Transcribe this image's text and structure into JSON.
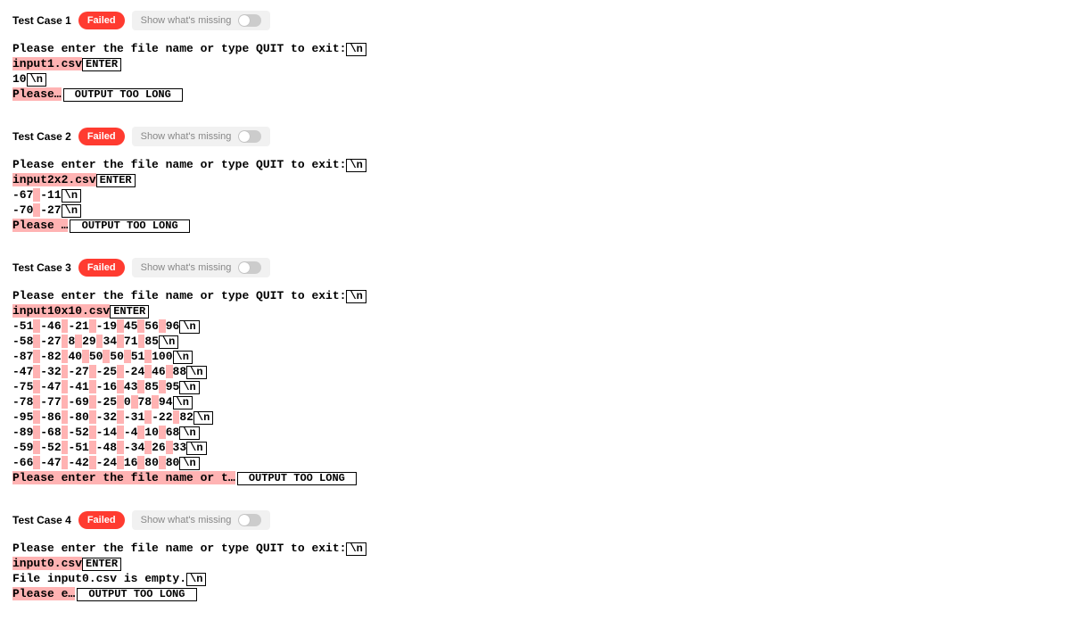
{
  "labels": {
    "swm": "Show what's missing",
    "nl": "\\n",
    "enter": "ENTER",
    "otl": "OUTPUT TOO LONG"
  },
  "tests": [
    {
      "title": "Test Case 1",
      "status": "Failed",
      "lines": [
        {
          "segs": [
            "Please enter the file name or type QUIT to exit:",
            {
              "t": "nl"
            }
          ]
        },
        {
          "segs": [
            {
              "hl": "input1.csv"
            },
            {
              "t": "enter"
            }
          ]
        },
        {
          "segs": [
            "10",
            {
              "t": "nl"
            }
          ]
        },
        {
          "segs": [
            {
              "hl": "Please…"
            },
            {
              "t": "otl"
            }
          ]
        }
      ]
    },
    {
      "title": "Test Case 2",
      "status": "Failed",
      "lines": [
        {
          "segs": [
            "Please enter the file name or type QUIT to exit:",
            {
              "t": "nl"
            }
          ]
        },
        {
          "segs": [
            {
              "hl": "input2x2.csv"
            },
            {
              "t": "enter"
            }
          ]
        },
        {
          "segs": [
            "-67",
            {
              "hl": " "
            },
            "-11",
            {
              "t": "nl"
            }
          ]
        },
        {
          "segs": [
            "-70",
            {
              "hl": " "
            },
            "-27",
            {
              "t": "nl"
            }
          ]
        },
        {
          "segs": [
            {
              "hl": "Please …"
            },
            {
              "t": "otl"
            }
          ]
        }
      ]
    },
    {
      "title": "Test Case 3",
      "status": "Failed",
      "lines": [
        {
          "segs": [
            "Please enter the file name or type QUIT to exit:",
            {
              "t": "nl"
            }
          ]
        },
        {
          "segs": [
            {
              "hl": "input10x10.csv"
            },
            {
              "t": "enter"
            }
          ]
        },
        {
          "segs": [
            "-51",
            {
              "hl": " "
            },
            "-46",
            {
              "hl": " "
            },
            "-21",
            {
              "hl": " "
            },
            "-19",
            {
              "hl": " "
            },
            "45",
            {
              "hl": " "
            },
            "56",
            {
              "hl": " "
            },
            "96",
            {
              "t": "nl"
            }
          ]
        },
        {
          "segs": [
            "-58",
            {
              "hl": " "
            },
            "-27",
            {
              "hl": " "
            },
            "8",
            {
              "hl": " "
            },
            "29",
            {
              "hl": " "
            },
            "34",
            {
              "hl": " "
            },
            "71",
            {
              "hl": " "
            },
            "85",
            {
              "t": "nl"
            }
          ]
        },
        {
          "segs": [
            "-87",
            {
              "hl": " "
            },
            "-82",
            {
              "hl": " "
            },
            "40",
            {
              "hl": " "
            },
            "50",
            {
              "hl": " "
            },
            "50",
            {
              "hl": " "
            },
            "51",
            {
              "hl": " "
            },
            "100",
            {
              "t": "nl"
            }
          ]
        },
        {
          "segs": [
            "-47",
            {
              "hl": " "
            },
            "-32",
            {
              "hl": " "
            },
            "-27",
            {
              "hl": " "
            },
            "-25",
            {
              "hl": " "
            },
            "-24",
            {
              "hl": " "
            },
            "46",
            {
              "hl": " "
            },
            "88",
            {
              "t": "nl"
            }
          ]
        },
        {
          "segs": [
            "-75",
            {
              "hl": " "
            },
            "-47",
            {
              "hl": " "
            },
            "-41",
            {
              "hl": " "
            },
            "-16",
            {
              "hl": " "
            },
            "43",
            {
              "hl": " "
            },
            "85",
            {
              "hl": " "
            },
            "95",
            {
              "t": "nl"
            }
          ]
        },
        {
          "segs": [
            "-78",
            {
              "hl": " "
            },
            "-77",
            {
              "hl": " "
            },
            "-69",
            {
              "hl": " "
            },
            "-25",
            {
              "hl": " "
            },
            "0",
            {
              "hl": " "
            },
            "78",
            {
              "hl": " "
            },
            "94",
            {
              "t": "nl"
            }
          ]
        },
        {
          "segs": [
            "-95",
            {
              "hl": " "
            },
            "-86",
            {
              "hl": " "
            },
            "-80",
            {
              "hl": " "
            },
            "-32",
            {
              "hl": " "
            },
            "-31",
            {
              "hl": " "
            },
            "-22",
            {
              "hl": " "
            },
            "82",
            {
              "t": "nl"
            }
          ]
        },
        {
          "segs": [
            "-89",
            {
              "hl": " "
            },
            "-68",
            {
              "hl": " "
            },
            "-52",
            {
              "hl": " "
            },
            "-14",
            {
              "hl": " "
            },
            "-4",
            {
              "hl": " "
            },
            "10",
            {
              "hl": " "
            },
            "68",
            {
              "t": "nl"
            }
          ]
        },
        {
          "segs": [
            "-59",
            {
              "hl": " "
            },
            "-52",
            {
              "hl": " "
            },
            "-51",
            {
              "hl": " "
            },
            "-48",
            {
              "hl": " "
            },
            "-34",
            {
              "hl": " "
            },
            "26",
            {
              "hl": " "
            },
            "33",
            {
              "t": "nl"
            }
          ]
        },
        {
          "segs": [
            "-66",
            {
              "hl": " "
            },
            "-47",
            {
              "hl": " "
            },
            "-42",
            {
              "hl": " "
            },
            "-24",
            {
              "hl": " "
            },
            "16",
            {
              "hl": " "
            },
            "80",
            {
              "hl": " "
            },
            "80",
            {
              "t": "nl"
            }
          ]
        },
        {
          "segs": [
            {
              "hl": "Please enter the file name or t…"
            },
            {
              "t": "otl"
            }
          ]
        }
      ]
    },
    {
      "title": "Test Case 4",
      "status": "Failed",
      "lines": [
        {
          "segs": [
            "Please enter the file name or type QUIT to exit:",
            {
              "t": "nl"
            }
          ]
        },
        {
          "segs": [
            {
              "hl": "input0.csv"
            },
            {
              "t": "enter"
            }
          ]
        },
        {
          "segs": [
            "File input0.csv is empty.",
            {
              "t": "nl"
            }
          ]
        },
        {
          "segs": [
            {
              "hl": "Please e…"
            },
            {
              "t": "otl"
            }
          ]
        }
      ]
    }
  ]
}
